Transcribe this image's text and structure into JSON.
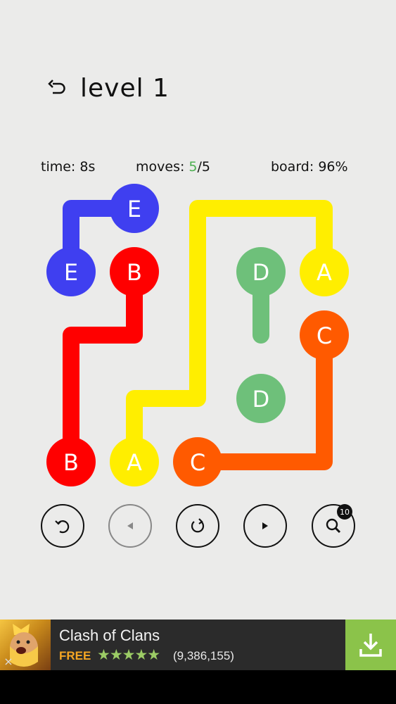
{
  "header": {
    "title": "level 1",
    "back_icon": "undo-arrow-icon"
  },
  "stats": {
    "time_label": "time:",
    "time_value": "8s",
    "moves_label": "moves:",
    "moves_current": "5",
    "moves_total": "/5",
    "board_label": "board:",
    "board_value": "96%"
  },
  "board": {
    "grid_size": 5,
    "colors": {
      "A": "#ffee00",
      "B": "#ff0000",
      "C": "#ff5a00",
      "D": "#6ec07a",
      "E": "#3f3ff0"
    },
    "dots": [
      {
        "label": "E",
        "row": 0,
        "col": 1
      },
      {
        "label": "E",
        "row": 1,
        "col": 0
      },
      {
        "label": "B",
        "row": 1,
        "col": 1
      },
      {
        "label": "D",
        "row": 1,
        "col": 3
      },
      {
        "label": "A",
        "row": 1,
        "col": 4
      },
      {
        "label": "C",
        "row": 2,
        "col": 4
      },
      {
        "label": "D",
        "row": 3,
        "col": 3
      },
      {
        "label": "B",
        "row": 4,
        "col": 0
      },
      {
        "label": "A",
        "row": 4,
        "col": 1
      },
      {
        "label": "C",
        "row": 4,
        "col": 2
      }
    ],
    "paths": [
      {
        "label": "E",
        "cells": [
          [
            1,
            0
          ],
          [
            0,
            0
          ],
          [
            0,
            1
          ]
        ]
      },
      {
        "label": "B",
        "cells": [
          [
            1,
            1
          ],
          [
            2,
            1
          ],
          [
            2,
            0
          ],
          [
            4,
            0
          ]
        ]
      },
      {
        "label": "A",
        "cells": [
          [
            1,
            4
          ],
          [
            0,
            4
          ],
          [
            0,
            2
          ],
          [
            3,
            2
          ],
          [
            3,
            1
          ],
          [
            4,
            1
          ]
        ]
      },
      {
        "label": "C",
        "cells": [
          [
            4,
            2
          ],
          [
            4,
            4
          ],
          [
            2,
            4
          ]
        ]
      },
      {
        "label": "D",
        "cells": [
          [
            1,
            3
          ],
          [
            2,
            3
          ]
        ]
      }
    ]
  },
  "controls": {
    "undo_icon": "undo-icon",
    "prev_icon": "previous-level-icon",
    "restart_icon": "restart-icon",
    "next_icon": "next-level-icon",
    "hint_icon": "hint-magnifier-icon",
    "hint_count": "10"
  },
  "ad": {
    "title": "Clash of Clans",
    "price": "FREE",
    "stars": "★★★★★",
    "rating_value": 4.5,
    "review_count": "(9,386,155)",
    "close_label": "×",
    "download_icon": "download-icon"
  }
}
